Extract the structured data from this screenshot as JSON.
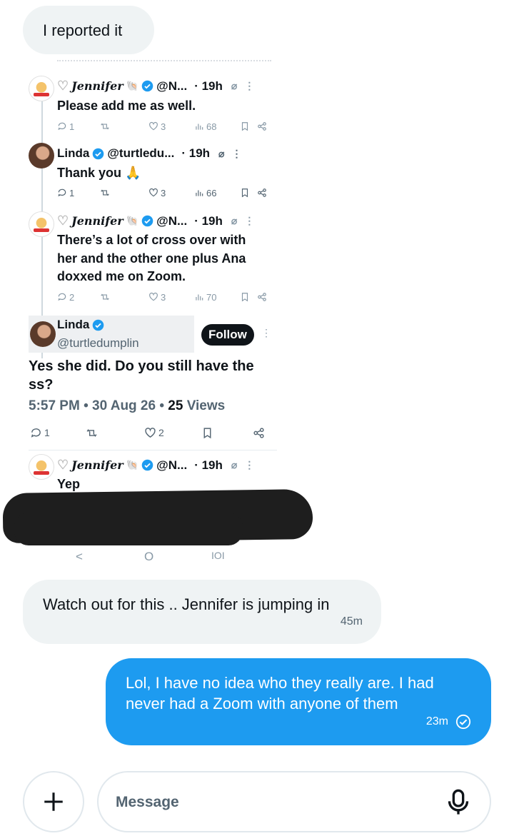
{
  "chat": {
    "msg1": {
      "text": "I reported it"
    },
    "msg2": {
      "text": "Watch out for this ..  Jennifer is jumping in",
      "time": "45m"
    },
    "msg3": {
      "line1": "Lol, I have no idea who they really are.  I had",
      "line2": "never had a Zoom with anyone of them",
      "time": "23m"
    }
  },
  "screenshot": {
    "tweet1": {
      "name": "Jennifer",
      "handle": "@N...",
      "time": "· 19h",
      "text": "Please add me as well.",
      "replies": "1",
      "likes": "3",
      "views": "68"
    },
    "tweet2": {
      "name": "Linda",
      "handle": "@turtledu...",
      "time": "· 19h",
      "text": "Thank you 🙏",
      "replies": "1",
      "likes": "3",
      "views": "66"
    },
    "tweet3": {
      "name": "Jennifer",
      "handle": "@N...",
      "time": "· 19h",
      "line1": "There’s a lot of cross over with",
      "line2": "her and the other one plus Ana",
      "line3": "doxxed me on Zoom.",
      "replies": "2",
      "likes": "3",
      "views": "70"
    },
    "main": {
      "name": "Linda",
      "handle": "@turtledumplin",
      "follow": "Follow",
      "line1": "Yes she did. Do you still have the",
      "line2": "ss?",
      "meta_time": "5:57 PM • 30 Aug 26 • ",
      "views_count": "25",
      "views_label": " Views",
      "replies": "1",
      "likes": "2"
    },
    "tweet5": {
      "name": "Jennifer",
      "handle": "@N...",
      "time": "· 19h",
      "text": "Yep"
    },
    "nav": {
      "back": "<",
      "home": "O",
      "recents": "IOI"
    }
  },
  "composer": {
    "placeholder": "Message"
  },
  "colors": {
    "accent": "#1d9bf0",
    "bubble_in": "#eff3f4",
    "verified": "#1d9bf0"
  },
  "icons": [
    "reply-icon",
    "retweet-icon",
    "like-icon",
    "views-icon",
    "bookmark-icon",
    "share-icon",
    "plus-icon",
    "mic-icon",
    "read-check-icon",
    "verified-icon"
  ]
}
